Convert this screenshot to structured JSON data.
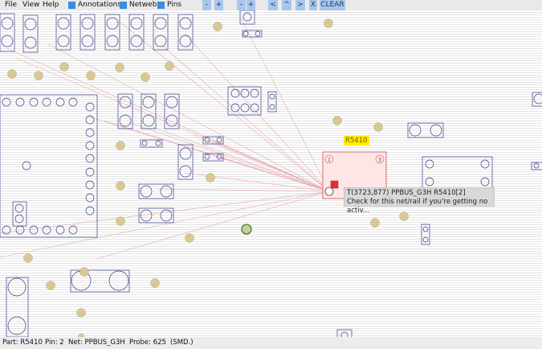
{
  "menu": {
    "file": "File",
    "view": "View",
    "help": "Help"
  },
  "toolbar": {
    "annotations_label": "Annotations",
    "annotations_checked": true,
    "netweb_label": "Netweb",
    "netweb_checked": true,
    "pins_label": "Pins",
    "pins_checked": true,
    "zoom_out": "-",
    "zoom_in": "+",
    "layer_out": "-",
    "layer_in": "+",
    "prev": "<",
    "up": "^",
    "next": ">",
    "close": "X",
    "clear": "CLEAR"
  },
  "board": {
    "part_label": "R5410",
    "pad_left_number": "1",
    "pad_right_number": "3",
    "tooltip_line1": "T(3723,877) PPBUS_G3H R5410[2]",
    "tooltip_line2": "Check for this net/rail if you're getting no activ..."
  },
  "status": {
    "part": "Part: R5410",
    "pin": "Pin: 2",
    "net": "Net: PPBUS_G3H",
    "probe": "Probe: 625",
    "type": "(SMD.)"
  },
  "colors": {
    "background_line": "#e2e2e2",
    "component_outline": "#3a3a8a",
    "test_point": "#d8c896",
    "netweb_line": "#e8a6b0",
    "selected_part_fill": "#ffe6e6",
    "selected_part_outline": "#d24a4a",
    "highlight": "#ffec00",
    "toolbar_checkbox": "#3b8be0"
  }
}
